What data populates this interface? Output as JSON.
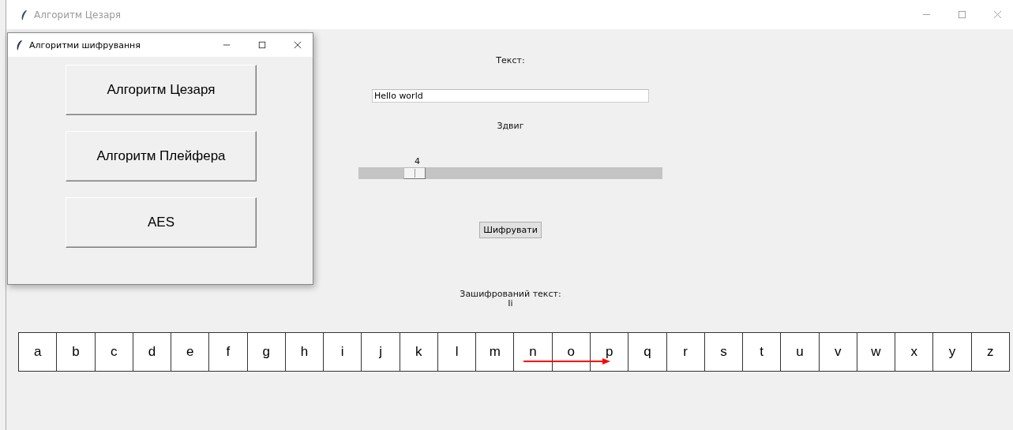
{
  "window": {
    "title": "Алгоритм Цезаря"
  },
  "dialog": {
    "title": "Алгоритми шифрування",
    "buttons": [
      "Алгоритм Цезаря",
      "Алгоритм Плейфера",
      "AES"
    ]
  },
  "text_label": "Текст:",
  "text_field": {
    "value": "Hello world"
  },
  "shift_label": "Здвиг",
  "shift_slider": {
    "reading": "4",
    "level": 0.16
  },
  "encrypt_button": "Шифрувати",
  "result_label": "Зашифрований текст:",
  "result_value": "Ii",
  "alphabet": [
    "a",
    "b",
    "c",
    "d",
    "e",
    "f",
    "g",
    "h",
    "i",
    "j",
    "k",
    "l",
    "m",
    "n",
    "o",
    "p",
    "q",
    "r",
    "s",
    "t",
    "u",
    "v",
    "w",
    "x",
    "y",
    "z"
  ]
}
